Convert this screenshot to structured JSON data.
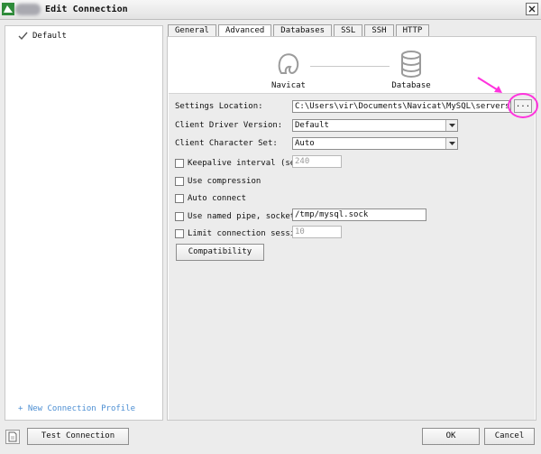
{
  "window": {
    "title": "Edit Connection"
  },
  "sidebar": {
    "profiles": [
      {
        "label": "Default",
        "selected": true
      }
    ],
    "new_profile_link": "+ New Connection Profile"
  },
  "tabs": [
    {
      "label": "General",
      "active": false
    },
    {
      "label": "Advanced",
      "active": true
    },
    {
      "label": "Databases",
      "active": false
    },
    {
      "label": "SSL",
      "active": false
    },
    {
      "label": "SSH",
      "active": false
    },
    {
      "label": "HTTP",
      "active": false
    }
  ],
  "diagram": {
    "left_label": "Navicat",
    "right_label": "Database"
  },
  "form": {
    "settings_location": {
      "label": "Settings Location:",
      "value": "C:\\Users\\vir\\Documents\\Navicat\\MySQL\\servers\\virdb",
      "browse_label": "..."
    },
    "client_driver": {
      "label": "Client Driver Version:",
      "value": "Default"
    },
    "client_charset": {
      "label": "Client Character Set:",
      "value": "Auto"
    },
    "keepalive": {
      "label": "Keepalive interval (sec):",
      "value": "240",
      "checked": false
    },
    "compression": {
      "label": "Use compression",
      "checked": false
    },
    "auto_connect": {
      "label": "Auto connect",
      "checked": false
    },
    "named_pipe": {
      "label": "Use named pipe, socket:",
      "value": "/tmp/mysql.sock",
      "checked": false
    },
    "limit_session": {
      "label": "Limit connection session",
      "value": "10",
      "checked": false
    },
    "compatibility_button": "Compatibility"
  },
  "footer": {
    "test_connection": "Test Connection",
    "ok": "OK",
    "cancel": "Cancel"
  },
  "colors": {
    "annotation": "#ff33dd",
    "link": "#4d8fd3"
  }
}
